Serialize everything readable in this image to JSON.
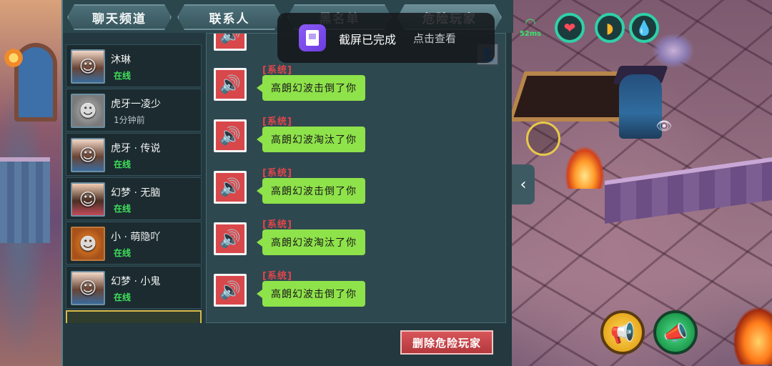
{
  "tabs": [
    {
      "label": "聊天频道"
    },
    {
      "label": "联系人"
    },
    {
      "label": "黑名单"
    },
    {
      "label": "危险玩家"
    }
  ],
  "contacts": [
    {
      "name": "沐琳",
      "status": "在线",
      "online": true,
      "avatar": "girl"
    },
    {
      "name": "虎牙一凌少",
      "status": "1分钟前",
      "online": false,
      "avatar": "cat"
    },
    {
      "name": "虎牙 · 传说",
      "status": "在线",
      "online": true,
      "avatar": "girl"
    },
    {
      "name": "幻梦 · 无脑",
      "status": "在线",
      "online": true,
      "avatar": "boy"
    },
    {
      "name": "小 · 萌隐吖",
      "status": "在线",
      "online": true,
      "avatar": "pumpkin"
    },
    {
      "name": "幻梦 · 小鬼",
      "status": "在线",
      "online": true,
      "avatar": "girl"
    }
  ],
  "messages": [
    {
      "tag": "[系统]",
      "text": "高朗幻波击倒了你"
    },
    {
      "tag": "[系统]",
      "text": "高朗幻波淘汰了你"
    },
    {
      "tag": "[系统]",
      "text": "高朗幻波击倒了你"
    },
    {
      "tag": "[系统]",
      "text": "高朗幻波淘汰了你"
    },
    {
      "tag": "[系统]",
      "text": "高朗幻波击倒了你"
    }
  ],
  "partial_message_text": "高朗幻波",
  "delete_button_label": "删除危险玩家",
  "toast": {
    "title": "截屏已完成",
    "action": "点击查看"
  },
  "hud": {
    "ping": "52ms"
  },
  "icons": {
    "message": "speaker-icon",
    "signal": "wifi-signal-icon",
    "health": "heart-icon",
    "hunger": "food-icon",
    "thirst": "water-drop-icon",
    "view": "eye-icon",
    "collapse": "chevron-left-icon",
    "horn_yellow": "megaphone-icon",
    "horn_green": "megaphone-icon"
  },
  "colors": {
    "message_tag": "#e0464a",
    "bubble": "#8ee24a",
    "online": "#3fe05a",
    "danger_button": "#c8474b",
    "toast_icon": "#7c4ef0"
  }
}
